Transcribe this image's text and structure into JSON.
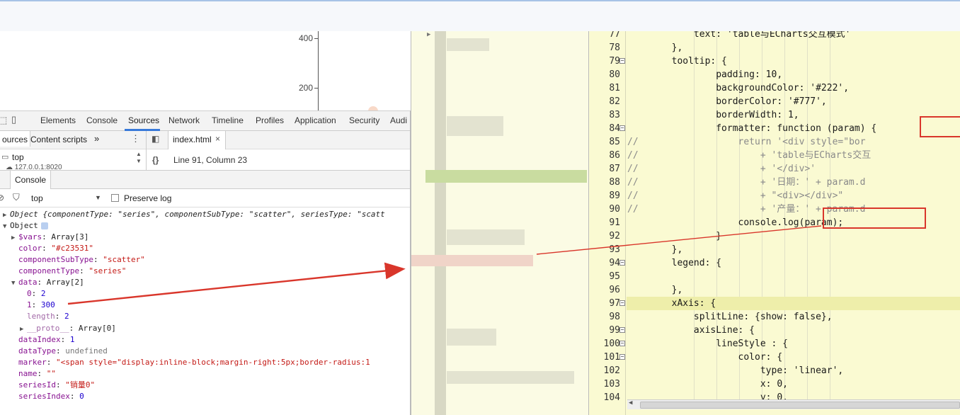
{
  "chart": {
    "ticks": [
      "400",
      "200"
    ]
  },
  "devtools": {
    "tabs": [
      "Elements",
      "Console",
      "Sources",
      "Network",
      "Timeline",
      "Profiles",
      "Application",
      "Security",
      "Audi"
    ],
    "sources": {
      "left_tabs": [
        "ources",
        "Content scripts"
      ],
      "more": "»",
      "file_tab": "index.html",
      "top_frame": "top",
      "origin": "127.0.0.1:8020",
      "cursor": "Line 91, Column 23"
    },
    "console": {
      "tab_label": "Console",
      "context": "top",
      "preserve_log": "Preserve log"
    }
  },
  "console_lines": [
    {
      "tri": "▶",
      "key": "",
      "sep": "",
      "val": "Object {componentType: \"series\", componentSubType: \"scatter\", seriesType: \"scatt",
      "indent": 0,
      "italic": true
    },
    {
      "tri": "▼",
      "key": "",
      "sep": "",
      "val": "Object",
      "indent": 0,
      "italic": false
    },
    {
      "tri": "▶",
      "key": "$vars",
      "sep": ": ",
      "val": "Array[3]",
      "indent": 1,
      "italic": false
    },
    {
      "tri": "",
      "key": "color",
      "sep": ": ",
      "val": "\"#c23531\"",
      "indent": 1,
      "italic": false
    },
    {
      "tri": "",
      "key": "componentSubType",
      "sep": ": ",
      "val": "\"scatter\"",
      "indent": 1,
      "italic": false
    },
    {
      "tri": "",
      "key": "componentType",
      "sep": ": ",
      "val": "\"series\"",
      "indent": 1,
      "italic": false
    },
    {
      "tri": "▼",
      "key": "data",
      "sep": ": ",
      "val": "Array[2]",
      "indent": 1,
      "italic": false
    },
    {
      "tri": "",
      "key": "0",
      "sep": ": ",
      "val": "2",
      "indent": 2,
      "italic": false
    },
    {
      "tri": "",
      "key": "1",
      "sep": ": ",
      "val": "300",
      "indent": 2,
      "italic": false
    },
    {
      "tri": "",
      "key": "length",
      "sep": ": ",
      "val": "2",
      "indent": 2,
      "italic": false
    },
    {
      "tri": "▶",
      "key": "__proto__",
      "sep": ": ",
      "val": "Array[0]",
      "indent": 2,
      "italic": false
    },
    {
      "tri": "",
      "key": "dataIndex",
      "sep": ": ",
      "val": "1",
      "indent": 1,
      "italic": false
    },
    {
      "tri": "",
      "key": "dataType",
      "sep": ": ",
      "val": "undefined",
      "indent": 1,
      "italic": false
    },
    {
      "tri": "",
      "key": "marker",
      "sep": ": ",
      "val": "\"<span style=\"display:inline-block;margin-right:5px;border-radius:1",
      "indent": 1,
      "italic": false
    },
    {
      "tri": "",
      "key": "name",
      "sep": ": ",
      "val": "\"\"",
      "indent": 1,
      "italic": false
    },
    {
      "tri": "",
      "key": "seriesId",
      "sep": ": ",
      "val": "\"销量0\"",
      "indent": 1,
      "italic": false
    },
    {
      "tri": "",
      "key": "seriesIndex",
      "sep": ": ",
      "val": "0",
      "indent": 1,
      "italic": false
    }
  ],
  "code_lines": [
    {
      "n": "77",
      "fold": "",
      "t": "            text: 'table与ECharts交互模式'"
    },
    {
      "n": "78",
      "fold": "",
      "t": "        },"
    },
    {
      "n": "79",
      "fold": "−",
      "t": "        tooltip: {"
    },
    {
      "n": "80",
      "fold": "",
      "t": "                padding: 10,"
    },
    {
      "n": "81",
      "fold": "",
      "t": "                backgroundColor: '#222',"
    },
    {
      "n": "82",
      "fold": "",
      "t": "                borderColor: '#777',"
    },
    {
      "n": "83",
      "fold": "",
      "t": "                borderWidth: 1,"
    },
    {
      "n": "84",
      "fold": "−",
      "t": "                formatter: function (param) {"
    },
    {
      "n": "85",
      "fold": "",
      "t": "//                  return '<div style=\"bor"
    },
    {
      "n": "86",
      "fold": "",
      "t": "//                      + 'table与ECharts交互"
    },
    {
      "n": "87",
      "fold": "",
      "t": "//                      + '</div>'"
    },
    {
      "n": "88",
      "fold": "",
      "t": "//                      + '日期：' + param.d"
    },
    {
      "n": "89",
      "fold": "",
      "t": "//                      + \"<div></div>\""
    },
    {
      "n": "90",
      "fold": "",
      "t": "//                      + '产量：' + param.d"
    },
    {
      "n": "91",
      "fold": "",
      "t": "                    console.log(param);"
    },
    {
      "n": "92",
      "fold": "",
      "t": "                }"
    },
    {
      "n": "93",
      "fold": "",
      "t": "        },"
    },
    {
      "n": "94",
      "fold": "−",
      "t": "        legend: {"
    },
    {
      "n": "95",
      "fold": "",
      "t": ""
    },
    {
      "n": "96",
      "fold": "",
      "t": "        },"
    },
    {
      "n": "97",
      "fold": "−",
      "t": "        xAxis: {"
    },
    {
      "n": "98",
      "fold": "",
      "t": "            splitLine: {show: false},"
    },
    {
      "n": "99",
      "fold": "−",
      "t": "            axisLine: {"
    },
    {
      "n": "100",
      "fold": "−",
      "t": "                lineStyle : {"
    },
    {
      "n": "101",
      "fold": "−",
      "t": "                    color: {"
    },
    {
      "n": "102",
      "fold": "",
      "t": "                        type: 'linear',"
    },
    {
      "n": "103",
      "fold": "",
      "t": "                        x: 0,"
    },
    {
      "n": "104",
      "fold": "",
      "t": "                        y: 0,"
    }
  ],
  "annotation": {
    "color": "#d9362b"
  }
}
